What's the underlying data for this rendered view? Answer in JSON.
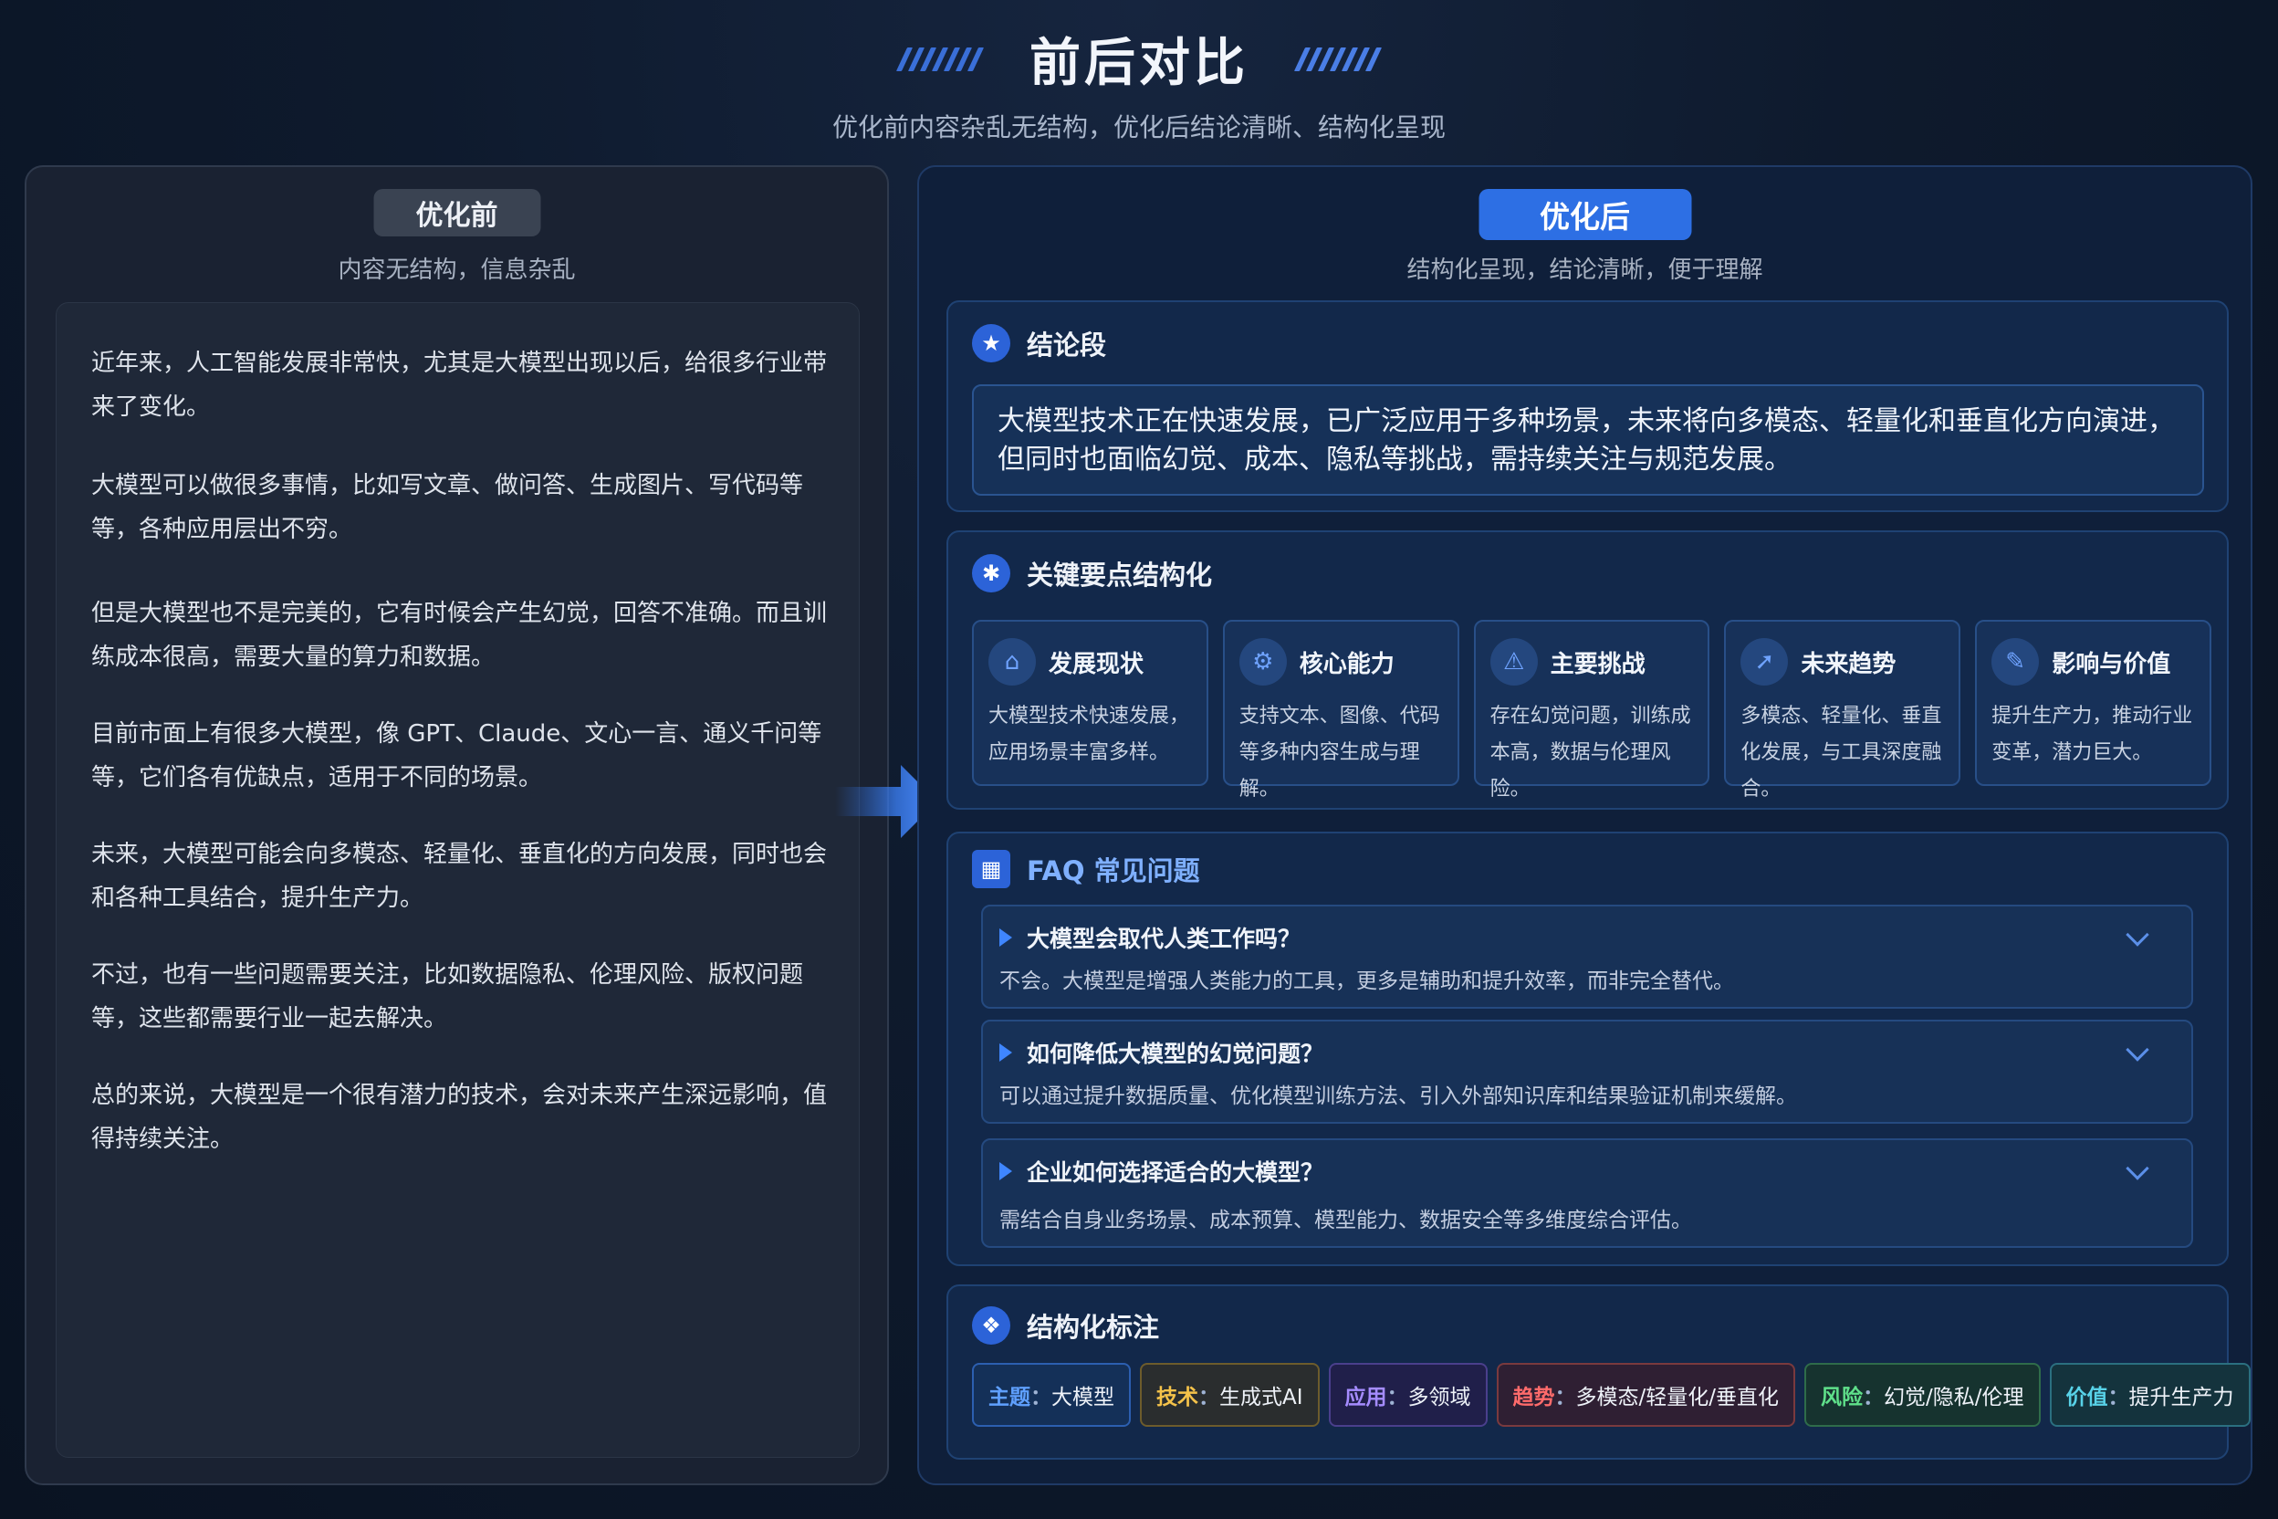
{
  "header": {
    "title": "前后对比",
    "subtitle": "优化前内容杂乱无结构，优化后结论清晰、结构化呈现"
  },
  "before": {
    "badge": "优化前",
    "subtitle": "内容无结构，信息杂乱",
    "paragraphs": [
      "近年来，人工智能发展非常快，尤其是大模型出现以后，给很多行业带来了变化。",
      "大模型可以做很多事情，比如写文章、做问答、生成图片、写代码等等，各种应用层出不穷。",
      "但是大模型也不是完美的，它有时候会产生幻觉，回答不准确。而且训练成本很高，需要大量的算力和数据。",
      "目前市面上有很多大模型，像 GPT、Claude、文心一言、通义千问等等，它们各有优缺点，适用于不同的场景。",
      "未来，大模型可能会向多模态、轻量化、垂直化的方向发展，同时也会和各种工具结合，提升生产力。",
      "不过，也有一些问题需要关注，比如数据隐私、伦理风险、版权问题等，这些都需要行业一起去解决。",
      "总的来说，大模型是一个很有潜力的技术，会对未来产生深远影响，值得持续关注。"
    ]
  },
  "after": {
    "badge": "优化后",
    "subtitle": "结构化呈现，结论清晰，便于理解",
    "conclusion": {
      "title": "结论段",
      "text": "大模型技术正在快速发展，已广泛应用于多种场景，未来将向多模态、轻量化和垂直化方向演进，但同时也面临幻觉、成本、隐私等挑战，需持续关注与规范发展。"
    },
    "keypoints": {
      "title": "关键要点结构化",
      "cards": [
        {
          "title": "发展现状",
          "desc": "大模型技术快速发展，应用场景丰富多样。",
          "icon": "home-icon"
        },
        {
          "title": "核心能力",
          "desc": "支持文本、图像、代码等多种内容生成与理解。",
          "icon": "gear-icon"
        },
        {
          "title": "主要挑战",
          "desc": "存在幻觉问题，训练成本高，数据与伦理风险。",
          "icon": "warning-icon"
        },
        {
          "title": "未来趋势",
          "desc": "多模态、轻量化、垂直化发展，与工具深度融合。",
          "icon": "rocket-icon"
        },
        {
          "title": "影响与价值",
          "desc": "提升生产力，推动行业变革，潜力巨大。",
          "icon": "edit-icon"
        }
      ]
    },
    "faq": {
      "title": "FAQ 常见问题",
      "items": [
        {
          "q": "大模型会取代人类工作吗？",
          "a": "不会。大模型是增强人类能力的工具，更多是辅助和提升效率，而非完全替代。"
        },
        {
          "q": "如何降低大模型的幻觉问题？",
          "a": "可以通过提升数据质量、优化模型训练方法、引入外部知识库和结果验证机制来缓解。"
        },
        {
          "q": "企业如何选择适合的大模型？",
          "a": "需结合自身业务场景、成本预算、模型能力、数据安全等多维度综合评估。"
        }
      ]
    },
    "tags": {
      "title": "结构化标注",
      "items": [
        {
          "key": "主题",
          "value": "大模型"
        },
        {
          "key": "技术",
          "value": "生成式AI"
        },
        {
          "key": "应用",
          "value": "多领域"
        },
        {
          "key": "趋势",
          "value": "多模态/轻量化/垂直化"
        },
        {
          "key": "风险",
          "value": "幻觉/隐私/伦理"
        },
        {
          "key": "价值",
          "value": "提升生产力"
        }
      ]
    }
  },
  "colors": {
    "accent": "#2d6fe4",
    "background": "#0e1a2d",
    "tag_topic": "#5fa0ff",
    "tag_tech": "#f4c24a",
    "tag_app": "#a58cff",
    "tag_trend": "#ff6b6b",
    "tag_risk": "#5fe08a",
    "tag_value": "#58d2e8"
  }
}
